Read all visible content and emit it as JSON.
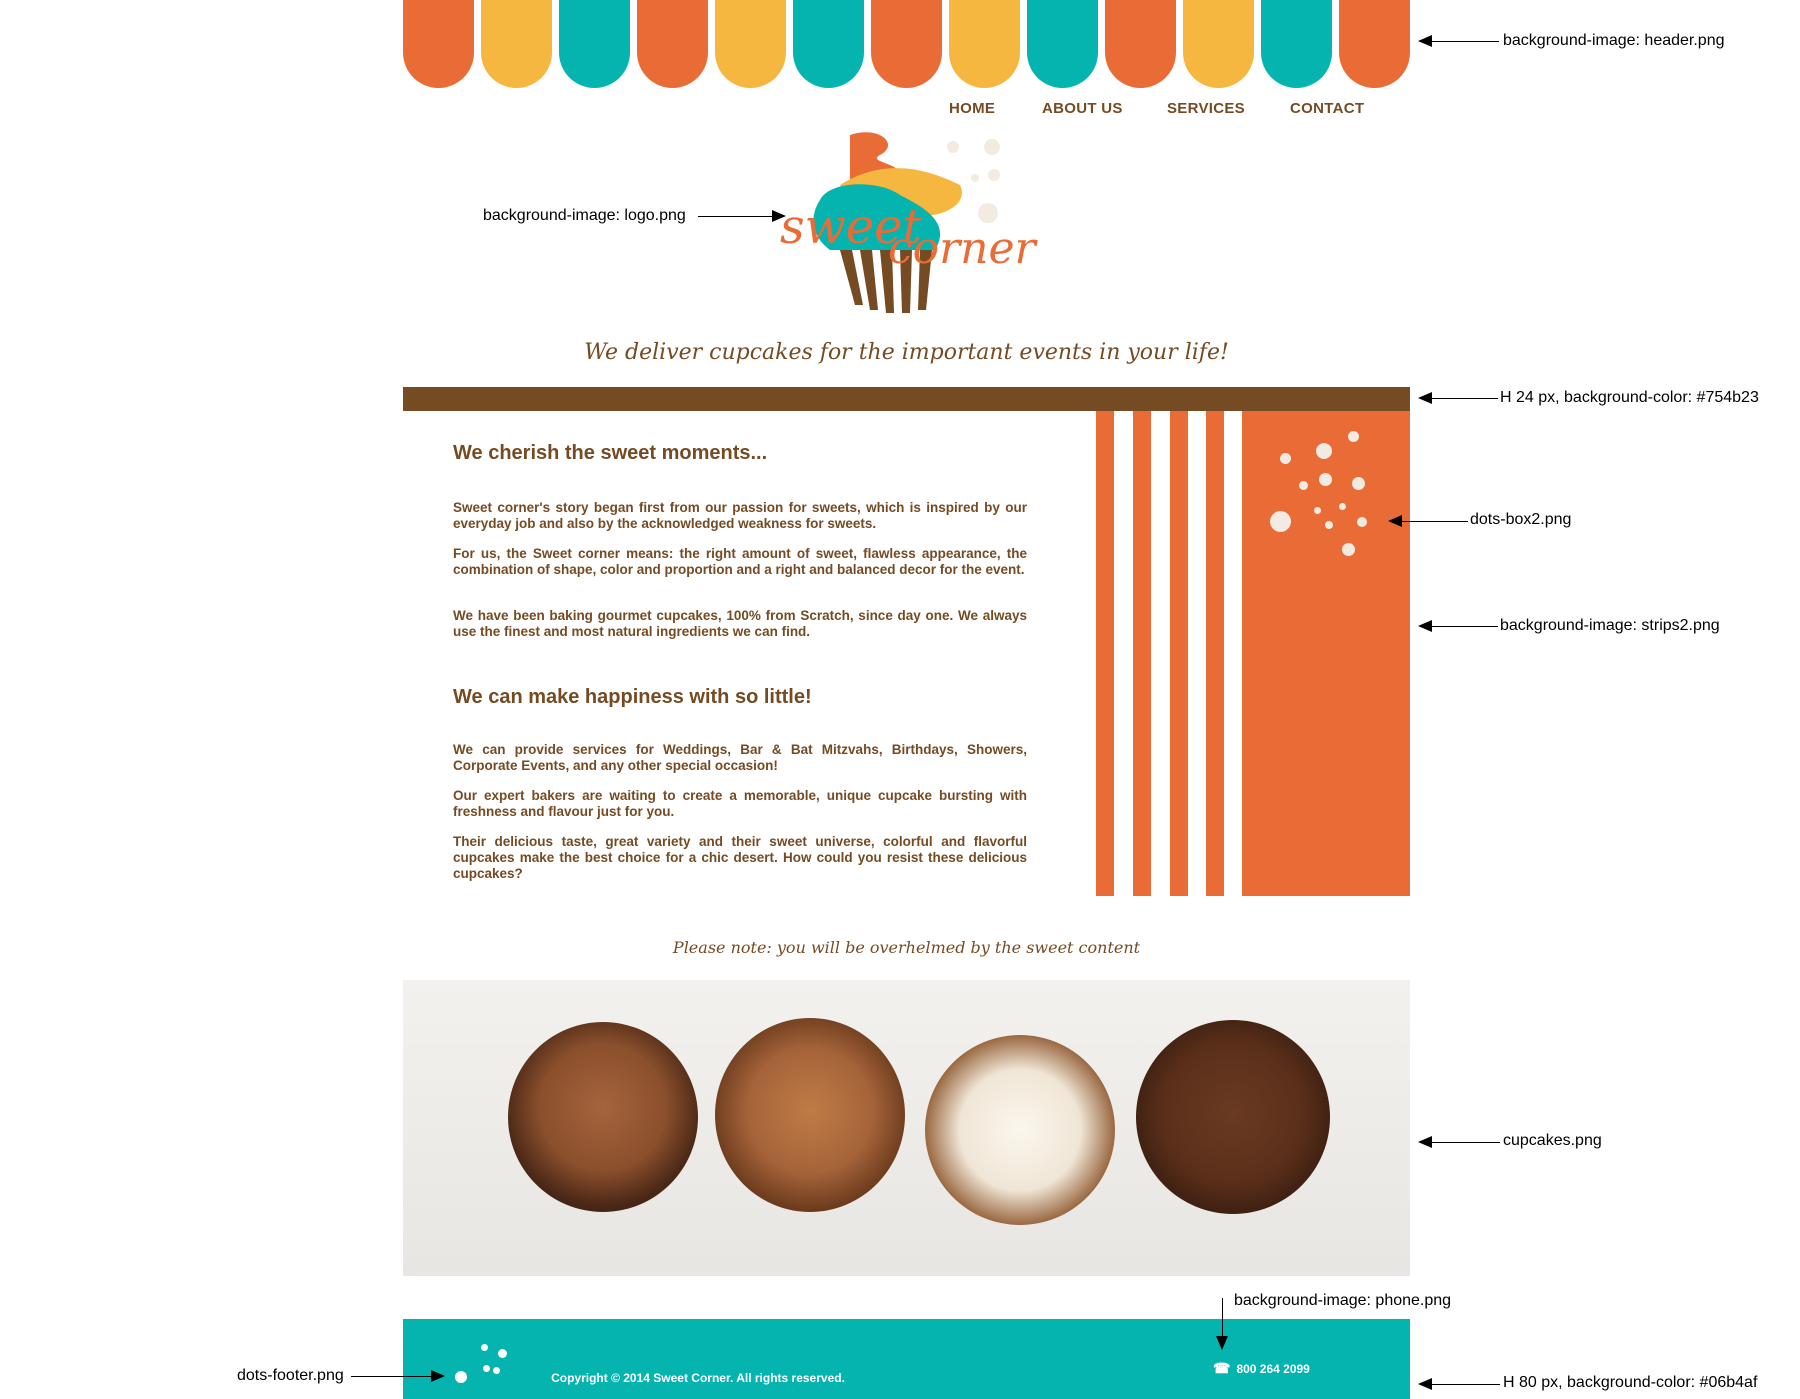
{
  "header": {
    "scallop_colors": [
      "#e96b36",
      "#f6b740",
      "#06b4af",
      "#e96b36",
      "#f6b740",
      "#06b4af",
      "#e96b36",
      "#f6b740",
      "#06b4af",
      "#e96b36",
      "#f6b740",
      "#06b4af",
      "#e96b36"
    ]
  },
  "nav": {
    "items": [
      "HOME",
      "ABOUT US",
      "SERVICES",
      "CONTACT"
    ]
  },
  "logo": {
    "word1": "sweet",
    "word2": "corner"
  },
  "tagline": "We deliver cupcakes for the important events in your life!",
  "section1": {
    "heading": "We cherish the sweet moments...",
    "paragraphs": [
      "Sweet corner's story began first from our passion for sweets, which is inspired by our everyday job and also by the acknowledged weakness for sweets.",
      "For us, the Sweet corner means: the right amount of sweet, flawless appearance, the combination of shape, color and proportion and a right and balanced decor for the event.",
      "We have been baking gourmet cupcakes, 100% from Scratch, since day one. We always use the finest and most natural ingredients we can find."
    ]
  },
  "section2": {
    "heading": "We can make happiness with so little!",
    "paragraphs": [
      "We can provide services for Weddings, Bar & Bat Mitzvahs, Birthdays, Showers, Corporate Events, and any other special occasion!",
      "Our expert bakers are waiting to create a memorable, unique cupcake bursting with freshness and flavour just for you.",
      "Their delicious taste, great variety and their sweet universe, colorful and flavorful cupcakes make the best choice for a chic desert. How could you resist these delicious cupcakes?"
    ]
  },
  "note": "Please note: you will be overhelmed by the sweet content",
  "footer": {
    "copyright": "Copyright © 2014 Sweet Corner. All rights reserved.",
    "phone": "800 264 2099"
  },
  "annotations": {
    "header": "background-image: header.png",
    "logo": "background-image: logo.png",
    "bar": "H 24 px, background-color: #754b23",
    "dots_box": "dots-box2.png",
    "strips": "background-image: strips2.png",
    "cupcakes": "cupcakes.png",
    "phone": "background-image: phone.png",
    "dots_footer": "dots-footer.png",
    "footer": "H 80 px, background-color: #06b4af"
  },
  "colors": {
    "brown": "#754b23",
    "orange": "#e96b36",
    "yellow": "#f6b740",
    "teal": "#06b4af"
  }
}
